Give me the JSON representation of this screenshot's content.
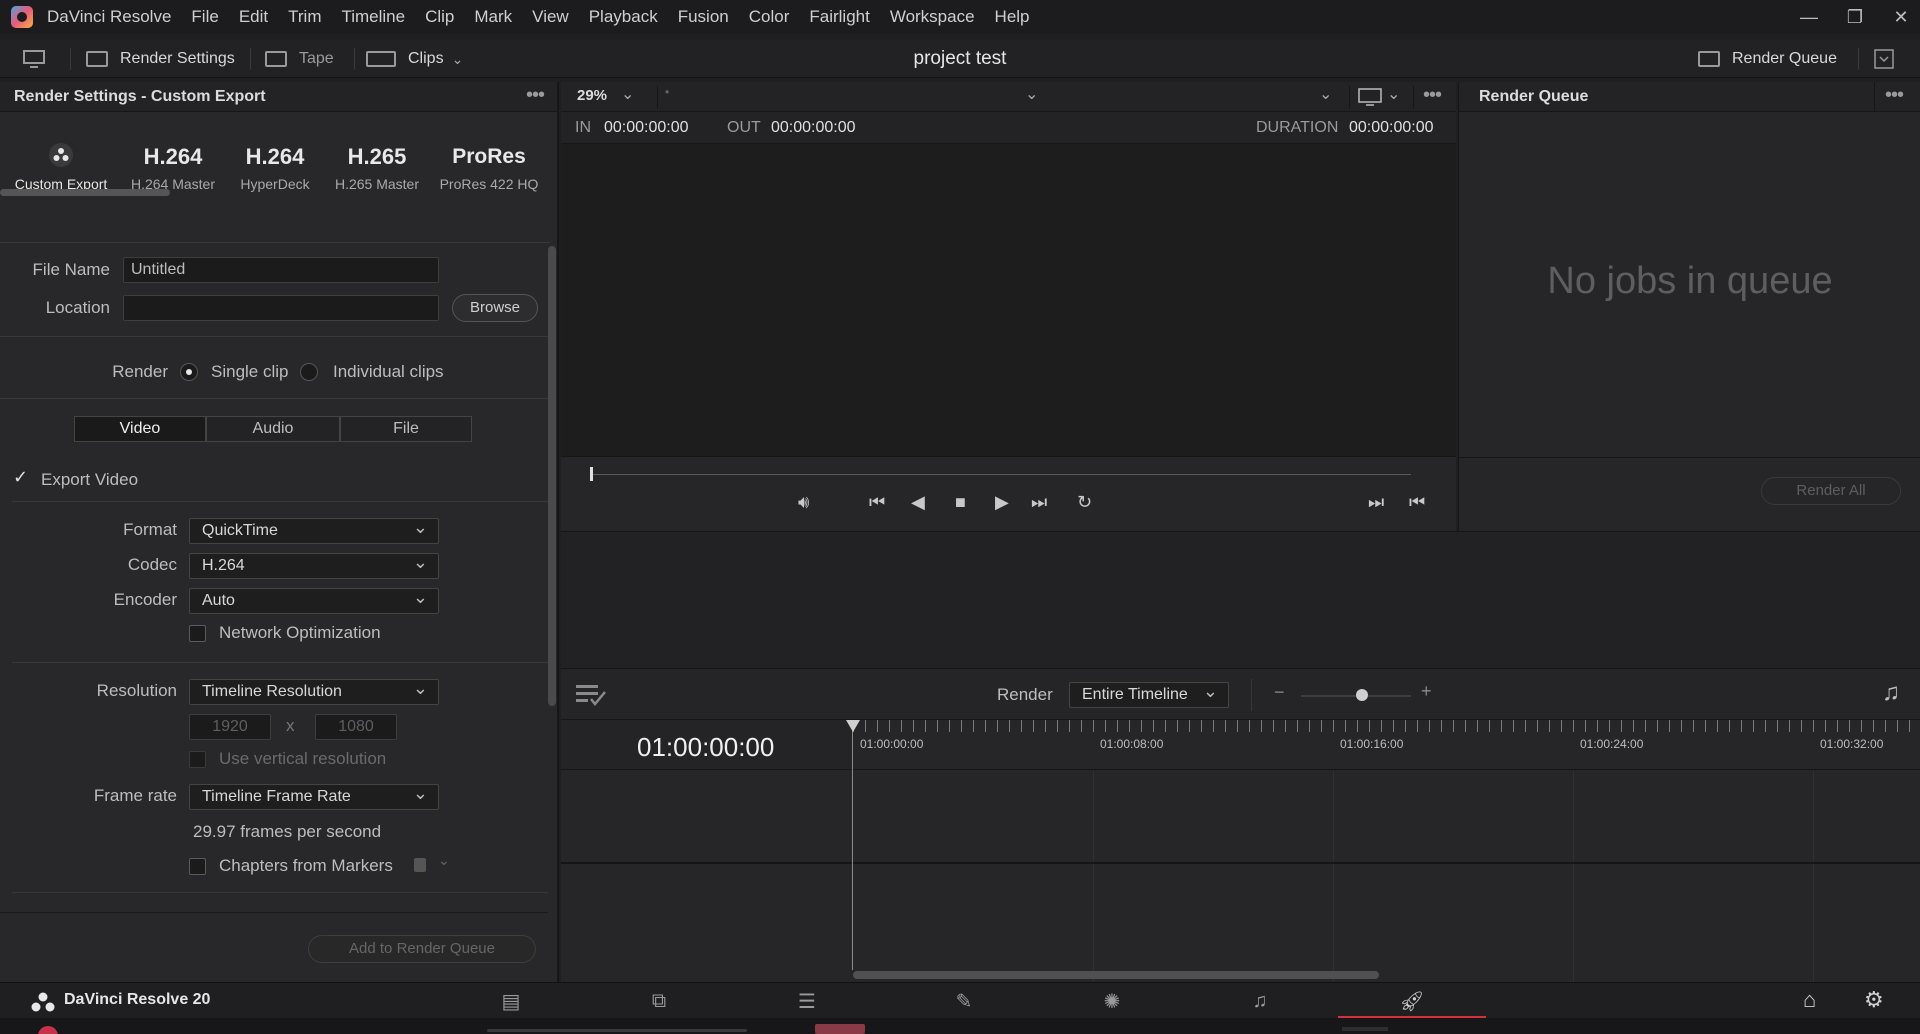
{
  "menubar": {
    "app_name": "DaVinci Resolve",
    "items": [
      "File",
      "Edit",
      "Trim",
      "Timeline",
      "Clip",
      "Mark",
      "View",
      "Playback",
      "Fusion",
      "Color",
      "Fairlight",
      "Workspace",
      "Help"
    ]
  },
  "toolbar": {
    "render_settings": "Render Settings",
    "tape": "Tape",
    "clips": "Clips",
    "project_title": "project test",
    "render_queue": "Render Queue"
  },
  "render_settings": {
    "header": "Render Settings - Custom Export",
    "presets": [
      {
        "big": "",
        "label": "Custom Export"
      },
      {
        "big": "H.264",
        "label": "H.264 Master"
      },
      {
        "big": "H.264",
        "label": "HyperDeck"
      },
      {
        "big": "H.265",
        "label": "H.265 Master"
      },
      {
        "big": "ProRes",
        "label": "ProRes 422 HQ"
      }
    ],
    "file_name_label": "File Name",
    "file_name_value": "Untitled",
    "location_label": "Location",
    "location_value": "",
    "browse": "Browse",
    "render_label": "Render",
    "single_clip": "Single clip",
    "individual_clips": "Individual clips",
    "tabs": [
      "Video",
      "Audio",
      "File"
    ],
    "export_video": "Export Video",
    "format_label": "Format",
    "format_value": "QuickTime",
    "codec_label": "Codec",
    "codec_value": "H.264",
    "encoder_label": "Encoder",
    "encoder_value": "Auto",
    "network_optimization": "Network Optimization",
    "resolution_label": "Resolution",
    "resolution_value": "Timeline Resolution",
    "res_width": "1920",
    "res_x": "x",
    "res_height": "1080",
    "use_vertical": "Use vertical resolution",
    "frame_rate_label": "Frame rate",
    "frame_rate_value": "Timeline Frame Rate",
    "fps_text": "29.97 frames per second",
    "chapters": "Chapters from Markers",
    "add_to_queue": "Add to Render Queue"
  },
  "viewer": {
    "zoom": "29%",
    "in_label": "IN",
    "in_tc": "00:00:00:00",
    "out_label": "OUT",
    "out_tc": "00:00:00:00",
    "duration_label": "DURATION",
    "duration_tc": "00:00:00:00"
  },
  "queue": {
    "title": "Render Queue",
    "empty_text": "No jobs in queue",
    "render_all": "Render All"
  },
  "timeline": {
    "render_label": "Render",
    "render_value": "Entire Timeline",
    "timecode": "01:00:00:00",
    "ruler": [
      "01:00:00:00",
      "01:00:08:00",
      "01:00:16:00",
      "01:00:24:00",
      "01:00:32:00"
    ]
  },
  "bottom": {
    "brand": "DaVinci Resolve 20",
    "pages": [
      "media-page-icon",
      "cut-page-icon",
      "edit-page-icon",
      "fusion-page-icon",
      "color-page-icon",
      "fairlight-page-icon",
      "deliver-page-icon"
    ],
    "active_page": "deliver-page-icon",
    "active_color": "#d2323c"
  }
}
